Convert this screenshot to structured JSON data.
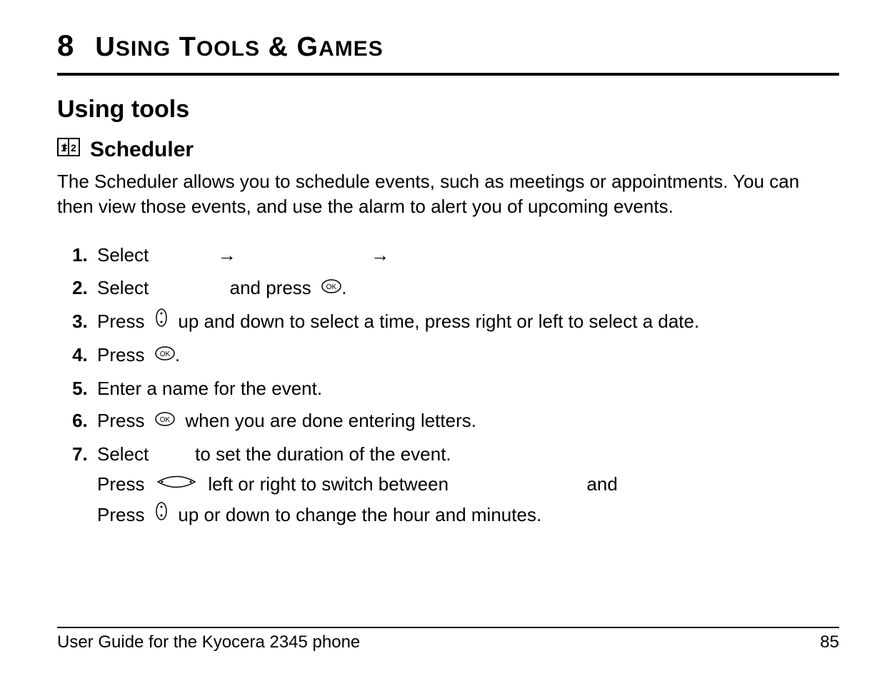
{
  "chapter": {
    "number": "8",
    "title_parts": [
      "U",
      "SING",
      " T",
      "OOLS",
      " & G",
      "AMES"
    ]
  },
  "section": {
    "heading": "Using tools"
  },
  "subsection": {
    "icon_name": "calendar-icon",
    "title": "Scheduler"
  },
  "body": "The Scheduler allows you to schedule events, such as meetings or appointments. You can then view those events, and use the alarm to alert you of upcoming events.",
  "steps": {
    "s1_a": "Select",
    "arrow": "→",
    "s2_a": "Select",
    "s2_b": "and press",
    "s2_c": ".",
    "s3_a": "Press",
    "s3_b": "up and down to select a time, press  right or left to select a date.",
    "s4_a": "Press",
    "s4_b": ".",
    "s5": "Enter a name for the event.",
    "s6_a": "Press",
    "s6_b": "when you are done entering letters.",
    "s7_a": "Select",
    "s7_b": "to set the duration of the event.",
    "s7_sub1_a": "Press",
    "s7_sub1_b": "left or right to switch between",
    "s7_sub1_c": "and",
    "s7_sub2_a": "Press",
    "s7_sub2_b": "up or down to change the hour and minutes."
  },
  "footer": {
    "left": "User Guide for the Kyocera 2345 phone",
    "right": "85"
  }
}
